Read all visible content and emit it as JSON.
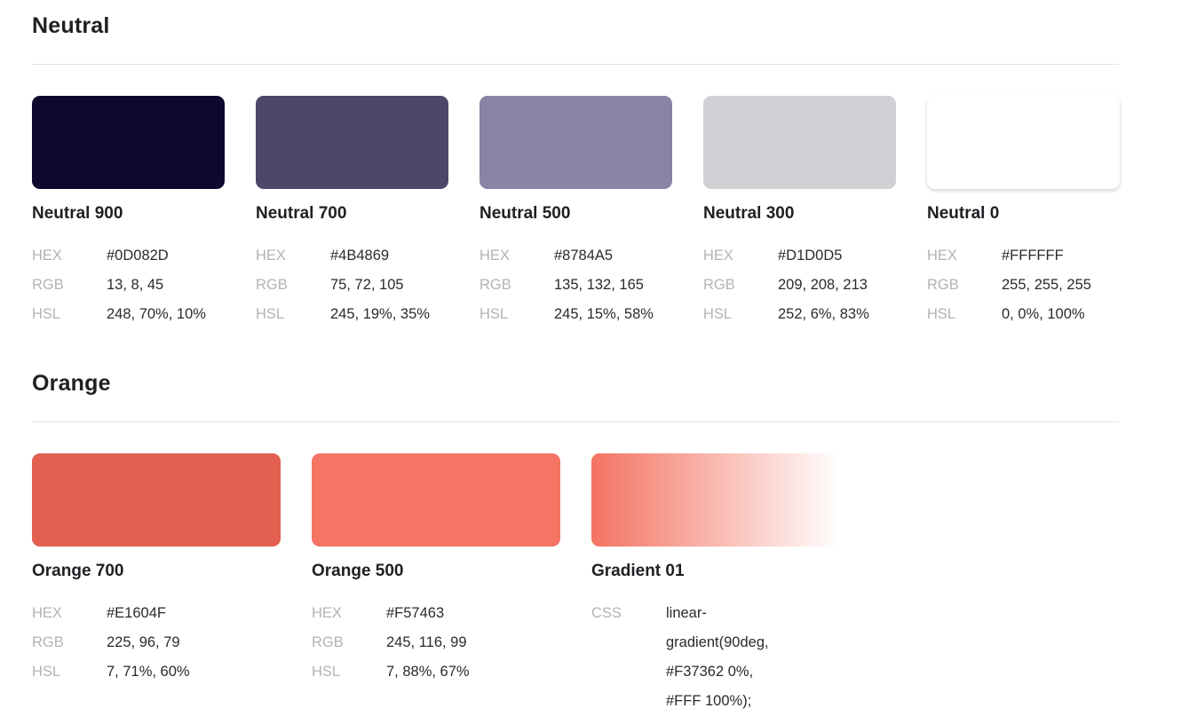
{
  "sections": [
    {
      "title": "Neutral",
      "colors": [
        {
          "name": "Neutral 900",
          "swatch": "#0D082D",
          "hex": "#0D082D",
          "rgb": "13, 8, 45",
          "hsl": "248, 70%, 10%"
        },
        {
          "name": "Neutral 700",
          "swatch": "#4B4869",
          "hex": "#4B4869",
          "rgb": "75, 72, 105",
          "hsl": "245, 19%, 35%"
        },
        {
          "name": "Neutral 500",
          "swatch": "#8784A5",
          "hex": "#8784A5",
          "rgb": "135, 132, 165",
          "hsl": "245, 15%, 58%"
        },
        {
          "name": "Neutral 300",
          "swatch": "#D1D0D5",
          "hex": "#D1D0D5",
          "rgb": "209, 208, 213",
          "hsl": "252, 6%, 83%"
        },
        {
          "name": "Neutral 0",
          "swatch": "#FFFFFF",
          "hex": "#FFFFFF",
          "rgb": "255, 255, 255",
          "hsl": "0, 0%, 100%"
        }
      ]
    },
    {
      "title": "Orange",
      "colors": [
        {
          "name": "Orange 700",
          "swatch": "#E1604F",
          "hex": "#E1604F",
          "rgb": "225, 96, 79",
          "hsl": "7, 71%, 60%"
        },
        {
          "name": "Orange 500",
          "swatch": "#F57463",
          "hex": "#F57463",
          "rgb": "245, 116, 99",
          "hsl": "7, 88%, 67%"
        },
        {
          "name": "Gradient 01",
          "swatch": "linear-gradient(90deg, #F37362 0%, #FFF 100%)",
          "css": "linear-gradient(90deg, #F37362 0%, #FFF 100%);"
        }
      ]
    }
  ],
  "labels": {
    "hex": "HEX",
    "rgb": "RGB",
    "hsl": "HSL",
    "css": "CSS"
  }
}
